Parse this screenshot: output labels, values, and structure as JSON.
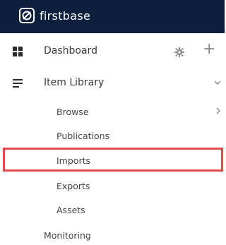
{
  "app": {
    "brand": "firstbase"
  },
  "nav": {
    "dashboard": {
      "label": "Dashboard"
    },
    "item_library": {
      "label": "Item Library"
    },
    "sub_items": [
      {
        "label": "Browse"
      },
      {
        "label": "Publications"
      },
      {
        "label": "Imports",
        "highlighted": true
      },
      {
        "label": "Exports"
      },
      {
        "label": "Assets"
      }
    ],
    "monitoring": {
      "label": "Monitoring"
    },
    "actions": {
      "add_symbol": "+"
    }
  },
  "colors": {
    "topbar": "#0d1f3c",
    "highlight_border": "#e34b4b",
    "icon_gray": "#8a8a8a",
    "logo_accent": "#ffffff"
  },
  "icons": [
    "firstbase-logo-icon",
    "grid-icon",
    "hamburger-icon",
    "gear-icon",
    "plus-icon",
    "chevron-down-icon",
    "chevron-right-icon"
  ]
}
